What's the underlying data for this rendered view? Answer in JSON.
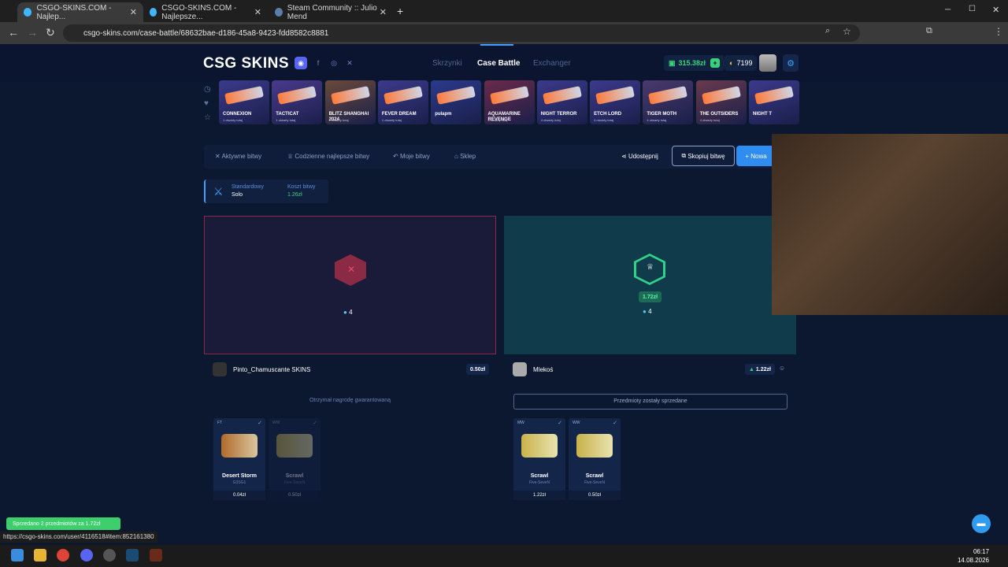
{
  "browser": {
    "tabs": [
      {
        "title": "CSGO-SKINS.COM - Najlep..."
      },
      {
        "title": "CSGO-SKINS.COM - Najlepsze..."
      },
      {
        "title": "Steam Community :: Julio Mend"
      }
    ],
    "url": "csgo-skins.com/case-battle/68632bae-d186-45a8-9423-fdd8582c8881"
  },
  "site": {
    "logo": "CSG SKINS",
    "menu": [
      "Skrzynki",
      "Case Battle",
      "Exchanger"
    ],
    "balance": "315.38zł",
    "coins": "7199",
    "cases": [
      {
        "name": "CONNEXION",
        "sub": "1 otwarty tutaj",
        "color": "#3b3a8c"
      },
      {
        "name": "TACTICAT",
        "sub": "1 otwarty tutaj",
        "color": "#4a3a8c"
      },
      {
        "name": "BLITZ SHANGHAI 2024",
        "sub": "1 otwarty tutaj",
        "color": "#6a4a3a"
      },
      {
        "name": "FEVER DREAM",
        "sub": "1 otwarty tutaj",
        "color": "#3b3a8c"
      },
      {
        "name": "pulapm",
        "sub": "",
        "color": "#2b3a8c"
      },
      {
        "name": "AQUAMARINE REVENGE",
        "sub": "4 otwarty tutaj",
        "color": "#6a2a4a"
      },
      {
        "name": "NIGHT TERROR",
        "sub": "4 otwarty tutaj",
        "color": "#3b3a8c"
      },
      {
        "name": "ETCH LORD",
        "sub": "4 otwarty tutaj",
        "color": "#3b3a8c"
      },
      {
        "name": "TIGER MOTH",
        "sub": "4 otwarty tutaj",
        "color": "#4a3a6c"
      },
      {
        "name": "THE OUTSIDERS",
        "sub": "4 otwarty tutaj",
        "color": "#6a3a4c"
      },
      {
        "name": "NIGHT T",
        "sub": "",
        "color": "#3b3a8c"
      }
    ],
    "battleTabs": [
      "Aktywne bitwy",
      "Codzienne najlepsze bitwy",
      "Moje bitwy",
      "Sklep"
    ],
    "share": "Udostępnij",
    "copy": "Skopiuj bitwę",
    "new": "Nowa",
    "mode_label": "Standardowy",
    "mode_value": "Solo",
    "cost_label": "Koszt bitwy",
    "cost_value": "1.26zł",
    "left": {
      "count": "4",
      "player": "Pinto_Chamuscante SKINS",
      "total": "0.50zł",
      "note": "Otrzymał nagrodę gwarantowaną",
      "items": [
        {
          "q": "FT",
          "name": "Desert Storm",
          "sub": "G3SG1",
          "price": "0.04zł"
        },
        {
          "q": "WW",
          "name": "Scrawl",
          "sub": "Five-SeveN",
          "price": "0.50zł"
        }
      ]
    },
    "right": {
      "win": "1.72zł",
      "count": "4",
      "player": "Mlekoś",
      "total": "1.22zł",
      "note": "Przedmioty zostały sprzedane",
      "items": [
        {
          "q": "MW",
          "name": "Scrawl",
          "sub": "Five-SeveN",
          "price": "1.22zł"
        },
        {
          "q": "WW",
          "name": "Scrawl",
          "sub": "Five-SeveN",
          "price": "0.50zł"
        }
      ]
    }
  },
  "status_url": "https://csgo-skins.com/user/4116518#item:852161380",
  "toast": "Sprzedano 2 przedmiotów za 1.72zł",
  "clock": {
    "time": "06:17",
    "date": "14.08.2026"
  }
}
